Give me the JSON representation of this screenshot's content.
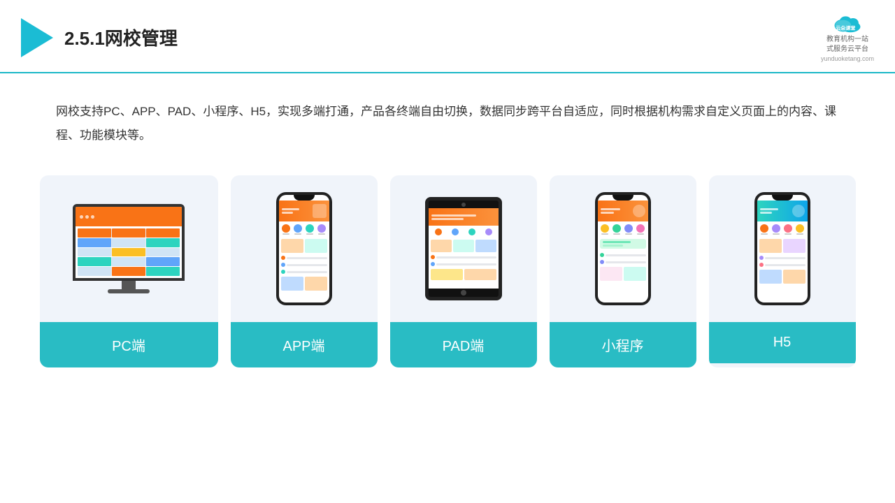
{
  "header": {
    "title": "2.5.1网校管理",
    "brand": {
      "name": "云朵课堂",
      "url": "yunduoketang.com",
      "tagline1": "教育机构一站",
      "tagline2": "式服务云平台"
    }
  },
  "description": "网校支持PC、APP、PAD、小程序、H5，实现多端打通，产品各终端自由切换，数据同步跨平台自适应，同时根据机构需求自定义页面上的内容、课程、功能模块等。",
  "cards": [
    {
      "id": "pc",
      "label": "PC端"
    },
    {
      "id": "app",
      "label": "APP端"
    },
    {
      "id": "pad",
      "label": "PAD端"
    },
    {
      "id": "miniprogram",
      "label": "小程序"
    },
    {
      "id": "h5",
      "label": "H5"
    }
  ],
  "accent_color": "#29bcc4"
}
